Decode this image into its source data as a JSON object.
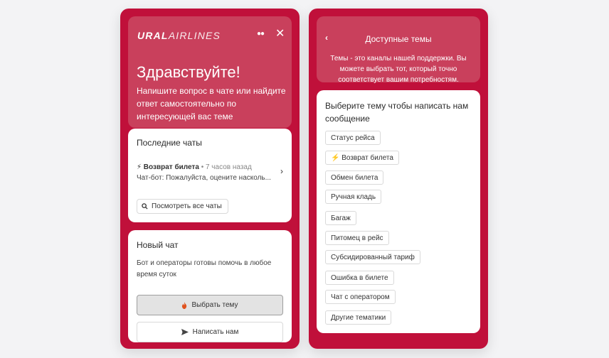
{
  "left": {
    "logo": {
      "ural": "URAL",
      "airlines": "AIRLINES"
    },
    "dots_icon": "more-dots-icon",
    "close_icon": "close-icon",
    "close_glyph": "✕",
    "greeting": "Здравствуйте!",
    "subtitle": "Напишите вопрос в чате или найдите ответ самостоятельно по интересующей вас теме",
    "recent": {
      "title": "Последние чаты",
      "chat": {
        "topic": "⚡ Возврат билета",
        "time": "• 7 часов назад",
        "preview": "Чат-бот: Пожалуйста, оцените насколь..."
      },
      "view_all": "Посмотреть все чаты"
    },
    "new_chat": {
      "title": "Новый чат",
      "description": "Бот и операторы готовы помочь в любое время суток",
      "choose_topic": "Выбрать тему",
      "write_us": "Написать нам"
    }
  },
  "right": {
    "title": "Доступные темы",
    "description": "Темы - это каналы нашей поддержки. Вы можете выбрать тот, который точно соответствует вашим потребностям.",
    "prompt": "Выберите тему чтобы написать нам сообщение",
    "topics": [
      "Статус рейса",
      "⚡ Возврат билета",
      "Обмен билета",
      "Ручная кладь",
      "Багаж",
      "Питомец в рейс",
      "Субсидированный тариф",
      "Ошибка в билете",
      "Чат с оператором",
      "Другие тематики"
    ]
  },
  "colors": {
    "brand": "#c0103a",
    "header_tint": "#c9405c",
    "background": "#f3f3f5"
  }
}
